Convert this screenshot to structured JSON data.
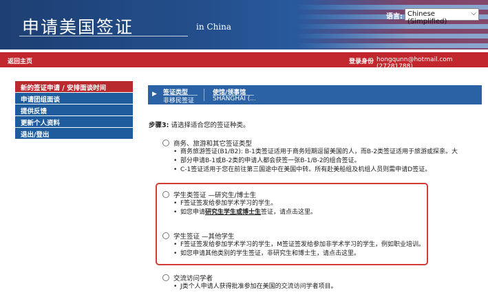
{
  "header": {
    "title": "申请美国签证",
    "subtitle": "in China",
    "language_label": "语言:",
    "language_value": "Chinese (Simplified)"
  },
  "topbar": {
    "home": "返回主页",
    "login_label": "登录身份",
    "login_value": "hongqunn@hotmail.com (27281788)"
  },
  "sidebar": {
    "items": [
      {
        "label": "新的签证申请 / 安排面谈时间",
        "active": true
      },
      {
        "label": "申请团组面谈"
      },
      {
        "label": "提供反馈"
      },
      {
        "label": "更新个人资料"
      },
      {
        "label": "退出/登出"
      }
    ]
  },
  "breadcrumb": {
    "step1_title": "签证类型",
    "step1_value": "非移民签证",
    "step2_title": "使馆/领事馆",
    "step2_value": "SHANGHAI (..."
  },
  "step": {
    "label": "步骤3:",
    "text": " 请选择适合您的签证种类。"
  },
  "options": [
    {
      "label": "商务、旅游和其它签证类型",
      "bullets": [
        "商务旅游签证(B1/B2): B-1类签证适用于商务短期逗留美国的人，而B-2类签证适用于旅游或探亲。大",
        "部分申请B-1或B-2类的申请人都会获签一张B-1/B-2的组合签证。",
        "C-1签证适用于您在前往第三国途中在美国中转。所有赴美船组及机组人员则需申请D签证。"
      ]
    },
    {
      "label": "学生类签证 —研究生/博士生",
      "bullets": [
        "F签证签发给参加学术学习的学生。",
        "如您申请",
        "研究生学生或博士生",
        "签证，请点击这里。"
      ]
    },
    {
      "label": "学生签证 —其他学生",
      "bullets": [
        "F签证签发给参加学术学习的学生，M签证签发给参加非学术学习的学生，例如职业培训。",
        "如您申请其他类别的学生签证，非研究生和博士生，请点击这里。"
      ]
    },
    {
      "label": "交流访问学者",
      "bullets": [
        "J类个人申请人获得批准参加在美国的交流访问学者项目。"
      ]
    }
  ],
  "colors": {
    "header_blue": "#24508e",
    "red_bar": "#c2272d",
    "sidebar_blue": "#1f5c9e",
    "sidebar_active": "#b92a2f",
    "highlight_box": "#d63a34"
  }
}
